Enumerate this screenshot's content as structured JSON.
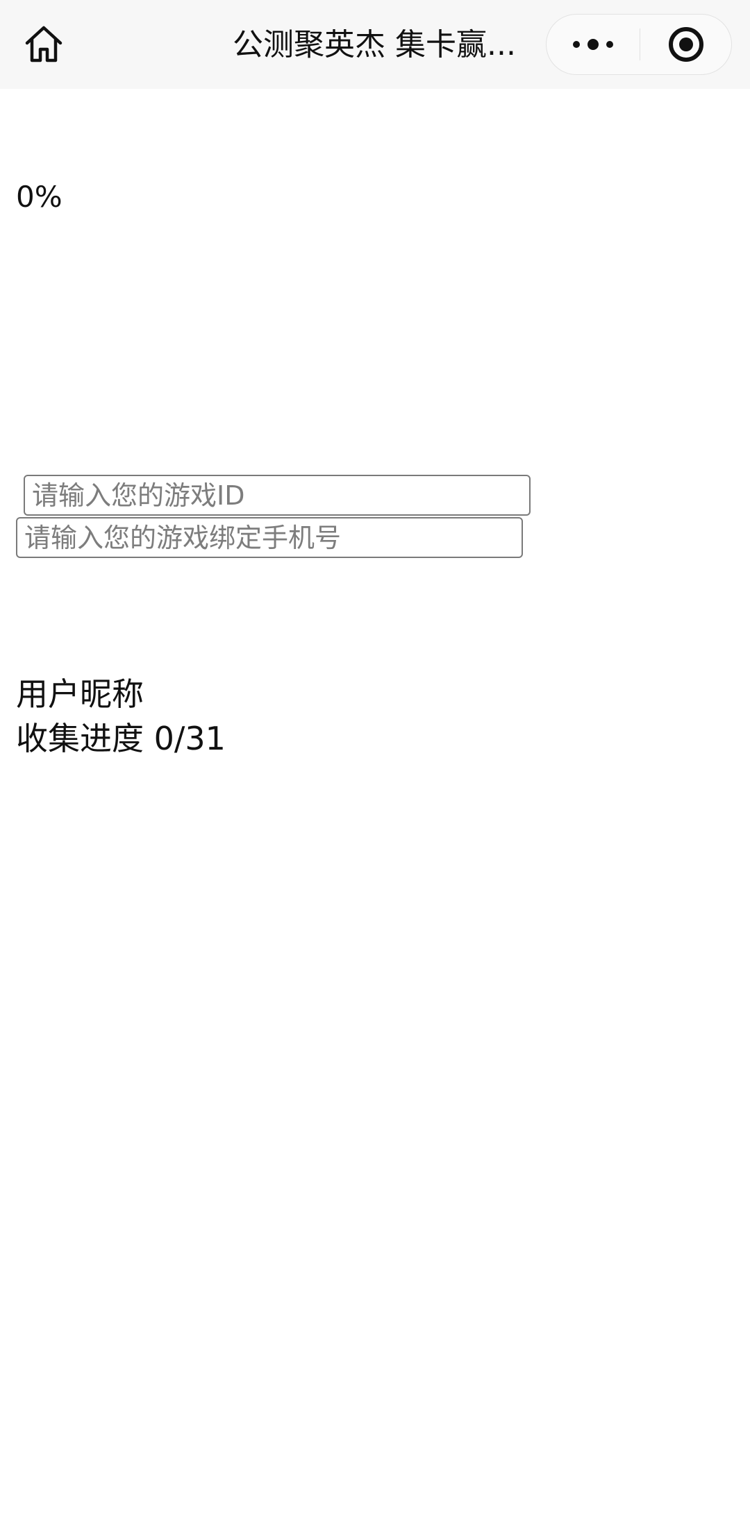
{
  "nav": {
    "title": "公测聚英杰 集卡赢...",
    "icons": {
      "home": "home-icon",
      "more": "more-dots-icon",
      "close": "target-close-icon"
    }
  },
  "page": {
    "percent": "0%",
    "game_id_placeholder": "请输入您的游戏ID",
    "phone_placeholder": "请输入您的游戏绑定手机号",
    "nickname": "用户昵称",
    "progress_label": "收集进度",
    "progress_value": "0/31"
  }
}
